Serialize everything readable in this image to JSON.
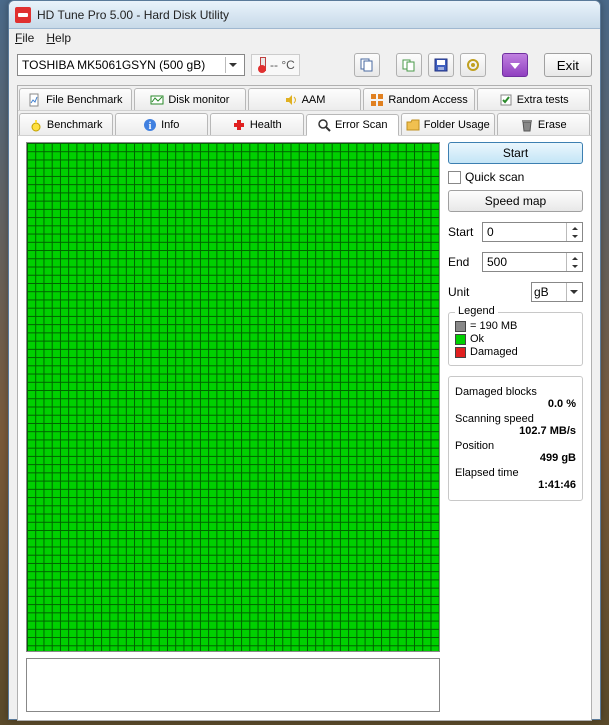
{
  "window": {
    "title": "HD Tune Pro 5.00 - Hard Disk Utility"
  },
  "menu": {
    "file": "File",
    "help": "Help"
  },
  "toolbar": {
    "drive": "TOSHIBA MK5061GSYN     (500 gB)",
    "temp": "-- °C",
    "exit": "Exit"
  },
  "tabs": {
    "row1": [
      "File Benchmark",
      "Disk monitor",
      "AAM",
      "Random Access",
      "Extra tests"
    ],
    "row2": [
      "Benchmark",
      "Info",
      "Health",
      "Error Scan",
      "Folder Usage",
      "Erase"
    ]
  },
  "panel": {
    "start": "Start",
    "quickscan": "Quick scan",
    "speedmap": "Speed map",
    "start_label": "Start",
    "start_val": "0",
    "end_label": "End",
    "end_val": "500",
    "unit_label": "Unit",
    "unit_val": "gB",
    "legend_title": "Legend",
    "legend_block": "= 190 MB",
    "legend_ok": "Ok",
    "legend_dmg": "Damaged",
    "stats": {
      "dmg_lbl": "Damaged blocks",
      "dmg_val": "0.0 %",
      "spd_lbl": "Scanning speed",
      "spd_val": "102.7 MB/s",
      "pos_lbl": "Position",
      "pos_val": "499 gB",
      "elp_lbl": "Elapsed time",
      "elp_val": "1:41:46"
    }
  }
}
